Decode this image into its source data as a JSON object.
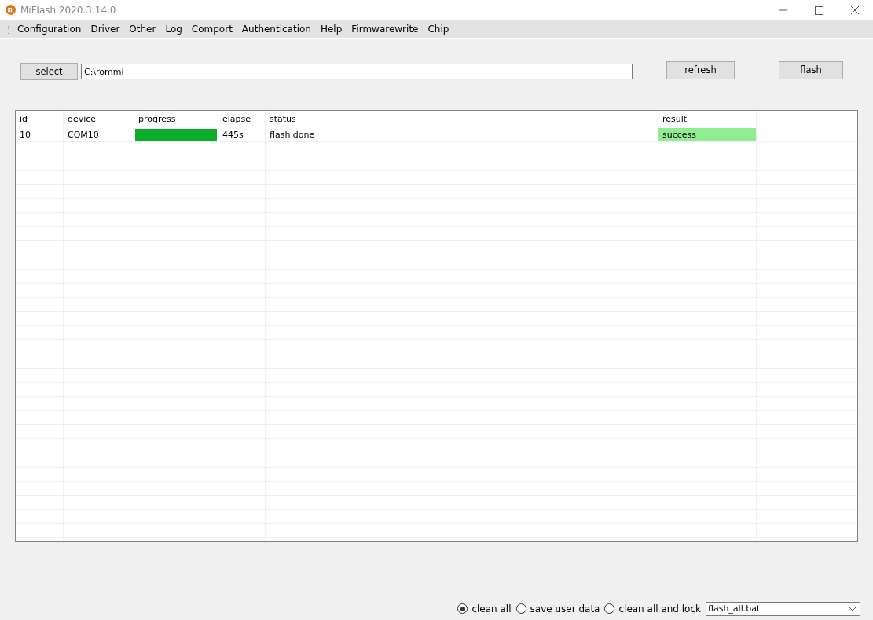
{
  "window": {
    "title": "MiFlash 2020.3.14.0"
  },
  "menu": [
    "Configuration",
    "Driver",
    "Other",
    "Log",
    "Comport",
    "Authentication",
    "Help",
    "Firmwarewrite",
    "Chip"
  ],
  "select_button": "select",
  "path_field": {
    "value": "C:\\rommi"
  },
  "refresh_button": "refresh",
  "flash_button": "flash",
  "table": {
    "columns": [
      "id",
      "device",
      "progress",
      "elapse",
      "status",
      "result"
    ],
    "rows": [
      {
        "id": "10",
        "device": "COM10",
        "level": 1,
        "elapse": "445s",
        "status": "flash done",
        "result": "success",
        "color": "#90ee90"
      }
    ]
  },
  "options": [
    {
      "label": "clean all",
      "selected": true
    },
    {
      "label": "save user data",
      "selected": false
    },
    {
      "label": "clean all and lock",
      "selected": false
    }
  ],
  "script_dropdown": {
    "value": "flash_all.bat"
  }
}
